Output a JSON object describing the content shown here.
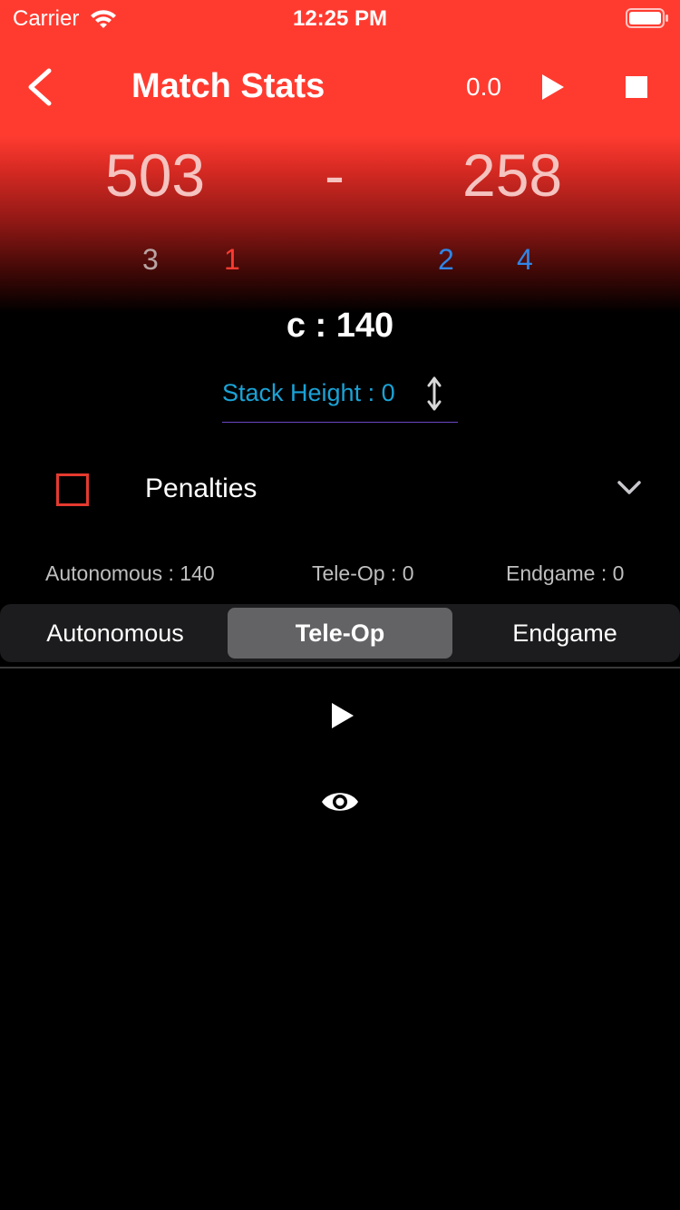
{
  "status_bar": {
    "carrier": "Carrier",
    "time": "12:25 PM"
  },
  "nav": {
    "title": "Match Stats",
    "timer": "0.0"
  },
  "scores": {
    "red": "503",
    "separator": "-",
    "blue": "258"
  },
  "teams": [
    "3",
    "1",
    "2",
    "4"
  ],
  "center_label": "c : 140",
  "stack": {
    "label": "Stack Height : 0"
  },
  "penalties": {
    "label": "Penalties",
    "checked": false
  },
  "phase_scores": {
    "autonomous": "Autonomous : 140",
    "teleop": "Tele-Op : 0",
    "endgame": "Endgame : 0"
  },
  "tabs": [
    {
      "label": "Autonomous"
    },
    {
      "label": "Tele-Op",
      "selected": true
    },
    {
      "label": "Endgame"
    }
  ],
  "colors": {
    "red_alliance": "#ff3b30",
    "blue_alliance": "#2f86e8",
    "accent": "#1aa3d6",
    "score_text": "#f5c3c0"
  },
  "icons": [
    "wifi-icon",
    "battery-icon",
    "back-icon",
    "play-icon",
    "stop-icon",
    "up-down-arrow-icon",
    "chevron-down-icon",
    "eye-icon"
  ]
}
